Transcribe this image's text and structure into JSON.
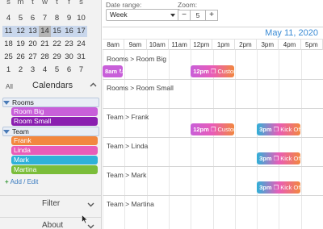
{
  "mini_calendar": {
    "dow": [
      "s",
      "m",
      "t",
      "w",
      "t",
      "f",
      "s"
    ],
    "rows": [
      [
        "4",
        "5",
        "6",
        "7",
        "8",
        "9",
        "10"
      ],
      [
        "11",
        "12",
        "13",
        "14",
        "15",
        "16",
        "17"
      ],
      [
        "18",
        "19",
        "20",
        "21",
        "22",
        "23",
        "24"
      ],
      [
        "25",
        "26",
        "27",
        "28",
        "29",
        "30",
        "31"
      ],
      [
        "1",
        "2",
        "3",
        "4",
        "5",
        "6",
        "7"
      ]
    ],
    "top_partial": [
      "",
      "",
      "",
      "",
      "",
      "",
      ""
    ]
  },
  "calendars": {
    "all_label": "All",
    "title": "Calendars",
    "groups": [
      {
        "name": "Rooms",
        "items": [
          {
            "label": "Room Big",
            "color": "#c85fd9"
          },
          {
            "label": "Room Small",
            "color": "#8a1fb0"
          }
        ]
      },
      {
        "name": "Team",
        "items": [
          {
            "label": "Frank",
            "color": "#f2873f"
          },
          {
            "label": "Linda",
            "color": "#e85cb8"
          },
          {
            "label": "Mark",
            "color": "#2fb1d8"
          },
          {
            "label": "Martina",
            "color": "#7bbd3a"
          }
        ]
      }
    ],
    "add_edit": "Add / Edit"
  },
  "accordion": {
    "filter": "Filter",
    "about": "About"
  },
  "toolbar": {
    "date_range_label": "Date range:",
    "date_range_value": "Week",
    "zoom_label": "Zoom:",
    "zoom_minus": "−",
    "zoom_value": "5",
    "zoom_plus": "+"
  },
  "timeline": {
    "date": "May 11, 2020",
    "hours": [
      "8am",
      "9am",
      "10am",
      "11am",
      "12pm",
      "1pm",
      "2pm",
      "3pm",
      "4pm",
      "5pm"
    ],
    "resources": [
      "Rooms > Room Big",
      "Rooms > Room Small",
      "Team > Frank",
      "Team > Linda",
      "Team > Mark",
      "Team > Martina"
    ],
    "events": [
      {
        "row": 0,
        "time": "8am",
        "title": "",
        "start_hour": 8.0,
        "end_hour": 8.95,
        "colors": [
          "#c85fd9",
          "#c85fd9"
        ],
        "icon": "repeat"
      },
      {
        "row": 0,
        "time": "12pm",
        "title": "Custom",
        "start_hour": 12.0,
        "end_hour": 14.0,
        "colors": [
          "#c85fd9",
          "#e85cb8",
          "#f2873f"
        ],
        "icon": "copy"
      },
      {
        "row": 2,
        "time": "12pm",
        "title": "Custom",
        "start_hour": 12.0,
        "end_hour": 14.0,
        "colors": [
          "#c85fd9",
          "#e85cb8",
          "#f2873f"
        ],
        "icon": "copy"
      },
      {
        "row": 2,
        "time": "3pm",
        "title": "Kick Off",
        "start_hour": 15.0,
        "end_hour": 17.0,
        "colors": [
          "#2fb1d8",
          "#e85cb8",
          "#f2873f"
        ],
        "icon": "copy"
      },
      {
        "row": 3,
        "time": "3pm",
        "title": "Kick Off",
        "start_hour": 15.0,
        "end_hour": 17.0,
        "colors": [
          "#2fb1d8",
          "#e85cb8",
          "#f2873f"
        ],
        "icon": "copy"
      },
      {
        "row": 4,
        "time": "3pm",
        "title": "Kick Off",
        "start_hour": 15.0,
        "end_hour": 17.0,
        "colors": [
          "#2fb1d8",
          "#e85cb8",
          "#f2873f"
        ],
        "icon": "copy"
      }
    ]
  }
}
